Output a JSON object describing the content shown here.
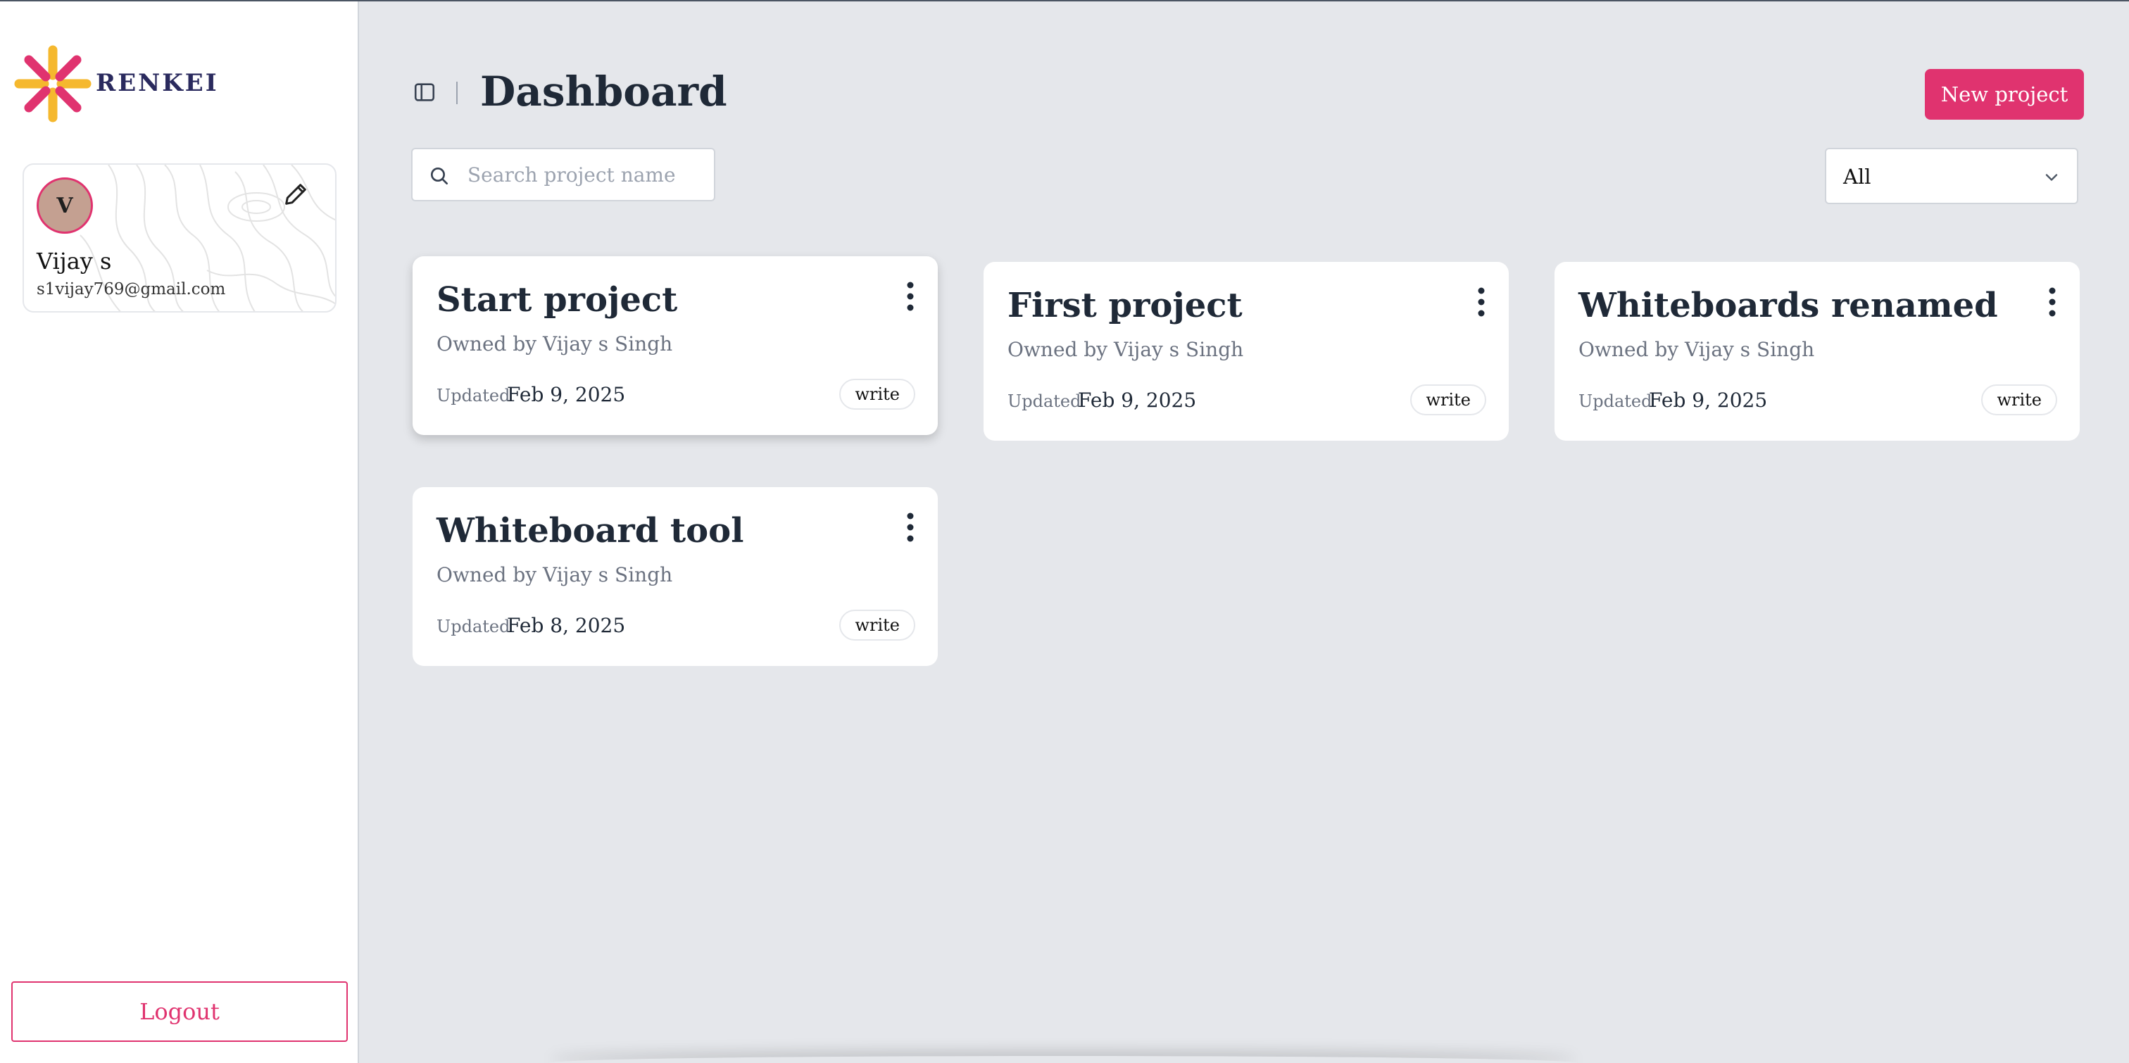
{
  "brand": {
    "name": "RENKEI"
  },
  "profile": {
    "initial": "V",
    "name": "Vijay s",
    "email": "s1vijay769@gmail.com"
  },
  "sidebar": {
    "logout_label": "Logout"
  },
  "header": {
    "title": "Dashboard",
    "new_project_label": "New project"
  },
  "search": {
    "placeholder": "Search project name",
    "value": ""
  },
  "filter": {
    "selected": "All"
  },
  "projects": [
    {
      "title": "Start project",
      "owner": "Owned by Vijay s Singh",
      "updated_label": "Updated",
      "updated_date": "Feb 9, 2025",
      "permission": "write"
    },
    {
      "title": "First project",
      "owner": "Owned by Vijay s Singh",
      "updated_label": "Updated",
      "updated_date": "Feb 9, 2025",
      "permission": "write"
    },
    {
      "title": "Whiteboards renamed",
      "owner": "Owned by Vijay s Singh",
      "updated_label": "Updated",
      "updated_date": "Feb 9, 2025",
      "permission": "write"
    },
    {
      "title": "Whiteboard tool",
      "owner": "Owned by Vijay s Singh",
      "updated_label": "Updated",
      "updated_date": "Feb 8, 2025",
      "permission": "write"
    }
  ],
  "colors": {
    "accent": "#e0336f",
    "background": "#e5e7eb",
    "logo_yellow": "#f5b82e",
    "logo_pink": "#e0336f"
  }
}
